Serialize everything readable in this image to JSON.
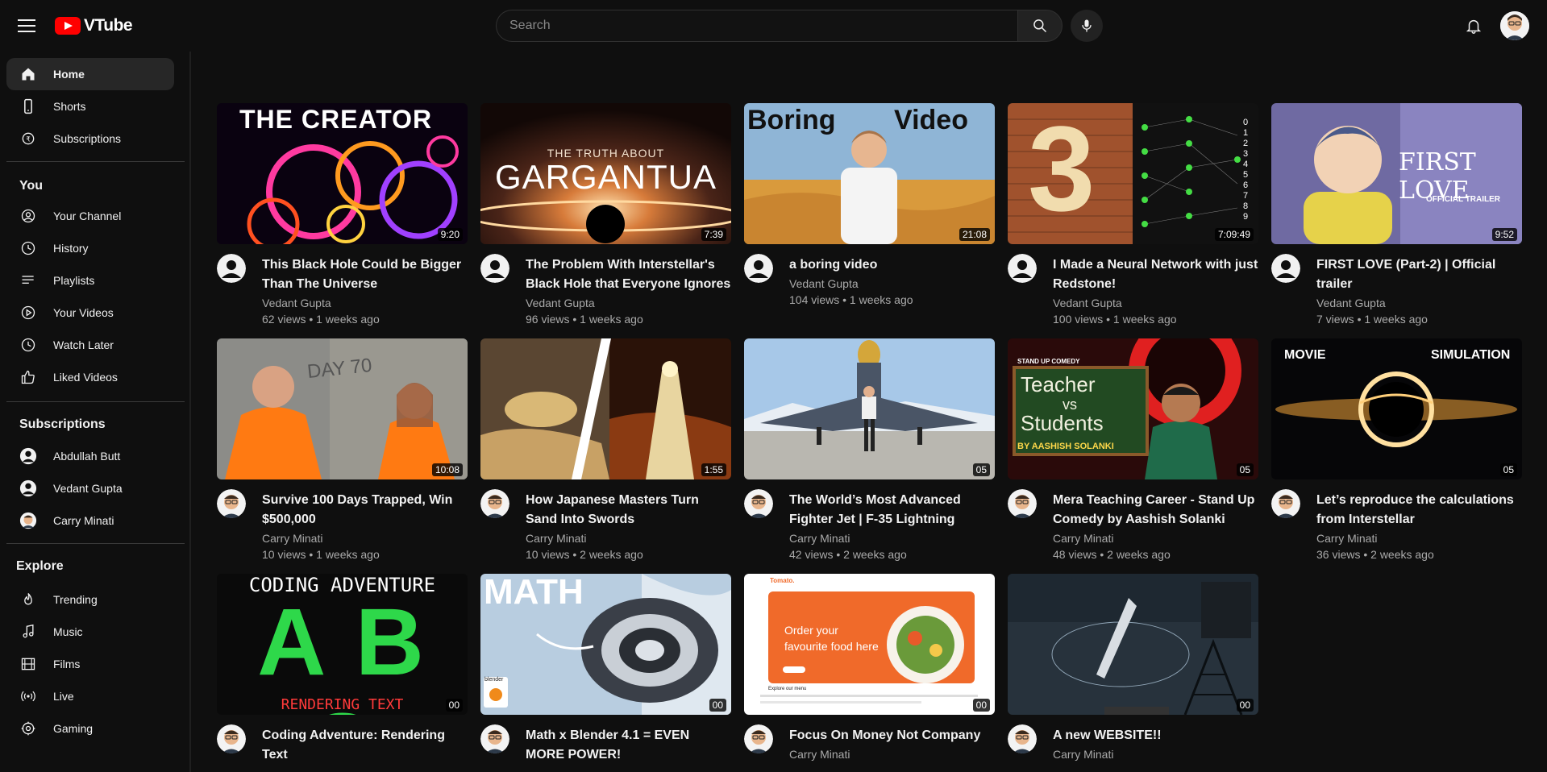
{
  "app": {
    "name": "VTube",
    "colors": {
      "brand": "#ff0000",
      "background": "#0f0f0f",
      "active": "#272727",
      "secondary_text": "#aaaaaa"
    }
  },
  "header": {
    "search_placeholder": "Search",
    "icons": [
      "menu-icon",
      "search-icon",
      "mic-icon",
      "bell-icon"
    ]
  },
  "sidebar": {
    "main": [
      {
        "label": "Home",
        "icon": "home-icon",
        "active": true
      },
      {
        "label": "Shorts",
        "icon": "shorts-icon"
      },
      {
        "label": "Subscriptions",
        "icon": "subscriptions-icon"
      }
    ],
    "you_heading": "You",
    "you": [
      {
        "label": "Your Channel",
        "icon": "user-circle-icon"
      },
      {
        "label": "History",
        "icon": "clock-icon"
      },
      {
        "label": "Playlists",
        "icon": "playlist-icon"
      },
      {
        "label": "Your Videos",
        "icon": "play-circle-icon"
      },
      {
        "label": "Watch Later",
        "icon": "clock-icon"
      },
      {
        "label": "Liked Videos",
        "icon": "thumb-up-icon"
      }
    ],
    "subs_heading": "Subscriptions",
    "subs": [
      {
        "label": "Abdullah Butt"
      },
      {
        "label": "Vedant Gupta"
      },
      {
        "label": "Carry Minati"
      }
    ],
    "explore_heading": "Explore",
    "explore": [
      {
        "label": "Trending",
        "icon": "flame-icon"
      },
      {
        "label": "Music",
        "icon": "music-icon"
      },
      {
        "label": "Films",
        "icon": "film-icon"
      },
      {
        "label": "Live",
        "icon": "live-icon"
      },
      {
        "label": "Gaming",
        "icon": "gaming-icon"
      }
    ]
  },
  "videos": [
    {
      "title_l1": "This Black Hole Could be Bigger",
      "title_l2": "Than The Universe",
      "channel": "Vedant Gupta",
      "stats": "62 views • 1 weeks ago",
      "duration": "9:20",
      "thumb_text": "THE CREATOR"
    },
    {
      "title_l1": "The Problem With Interstellar's",
      "title_l2": "Black Hole that Everyone Ignores",
      "channel": "Vedant Gupta",
      "stats": "96 views • 1 weeks ago",
      "duration": "7:39",
      "thumb_text_small": "THE TRUTH ABOUT",
      "thumb_text": "GARGANTUA"
    },
    {
      "title_l1": "a boring video",
      "title_l2": "",
      "channel": "Vedant Gupta",
      "stats": "104 views • 1 weeks ago",
      "duration": "21:08",
      "thumb_text": "Boring",
      "thumb_text_b": "Video"
    },
    {
      "title_l1": "I Made a Neural Network with just",
      "title_l2": "Redstone!",
      "channel": "Vedant Gupta",
      "stats": "100 views • 1 weeks ago",
      "duration": "7:09:49",
      "thumb_text": "3",
      "thumb_digits": "0 1 2 3 4 5 6 7 8 9"
    },
    {
      "title_l1": "FIRST LOVE (Part-2) | Official",
      "title_l2": "trailer",
      "channel": "Vedant Gupta",
      "stats": "7 views • 1 weeks ago",
      "duration": "9:52",
      "thumb_text": "FIRST LOVE",
      "thumb_text_small": "OFFICIAL TRAILER"
    },
    {
      "title_l1": "Survive 100 Days Trapped, Win",
      "title_l2": "$500,000",
      "channel": "Carry Minati",
      "stats": "10 views • 1 weeks ago",
      "duration": "10:08",
      "thumb_text": "DAY 70"
    },
    {
      "title_l1": "How Japanese Masters Turn",
      "title_l2": "Sand Into Swords",
      "channel": "Carry Minati",
      "stats": "10 views • 2 weeks ago",
      "duration": "1:55"
    },
    {
      "title_l1": "The World’s Most Advanced",
      "title_l2": "Fighter Jet | F-35 Lightning",
      "channel": "Carry Minati",
      "stats": "42 views • 2 weeks ago",
      "duration": "05"
    },
    {
      "title_l1": "Mera Teaching Career - Stand Up",
      "title_l2": "Comedy by Aashish Solanki",
      "channel": "Carry Minati",
      "stats": "48 views • 2 weeks ago",
      "duration": "05",
      "thumb_text_small": "STAND UP COMEDY",
      "thumb_text": "Teacher",
      "thumb_text_b": "vs",
      "thumb_text_c": "Students",
      "thumb_text_d": "BY AASHISH SOLANKI"
    },
    {
      "title_l1": "Let’s reproduce the calculations",
      "title_l2": "from Interstellar",
      "channel": "Carry Minati",
      "stats": "36 views • 2 weeks ago",
      "duration": "05",
      "thumb_text": "MOVIE",
      "thumb_text_b": "SIMULATION"
    },
    {
      "title_l1": "Coding Adventure: Rendering",
      "title_l2": "Text",
      "channel": "Carry Minati",
      "stats": "",
      "duration": "00",
      "thumb_text": "CODING ADVENTURE",
      "thumb_text_b": "A B C",
      "thumb_text_c": "RENDERING TEXT"
    },
    {
      "title_l1": "Math x Blender 4.1 = EVEN",
      "title_l2": "MORE POWER!",
      "channel": "Carry Minati",
      "stats": "",
      "duration": "00",
      "thumb_text": "MATH",
      "thumb_text_small": "blender"
    },
    {
      "title_l1": "Focus On Money Not Company",
      "title_l2": "",
      "channel": "Carry Minati",
      "stats": "",
      "duration": "00",
      "thumb_text_small": "Tomato.",
      "thumb_text": "Order your",
      "thumb_text_b": "favourite food here",
      "thumb_text_c": "Explore our menu"
    },
    {
      "title_l1": "A new WEBSITE!!",
      "title_l2": "",
      "channel": "Carry Minati",
      "stats": "",
      "duration": "00"
    }
  ]
}
